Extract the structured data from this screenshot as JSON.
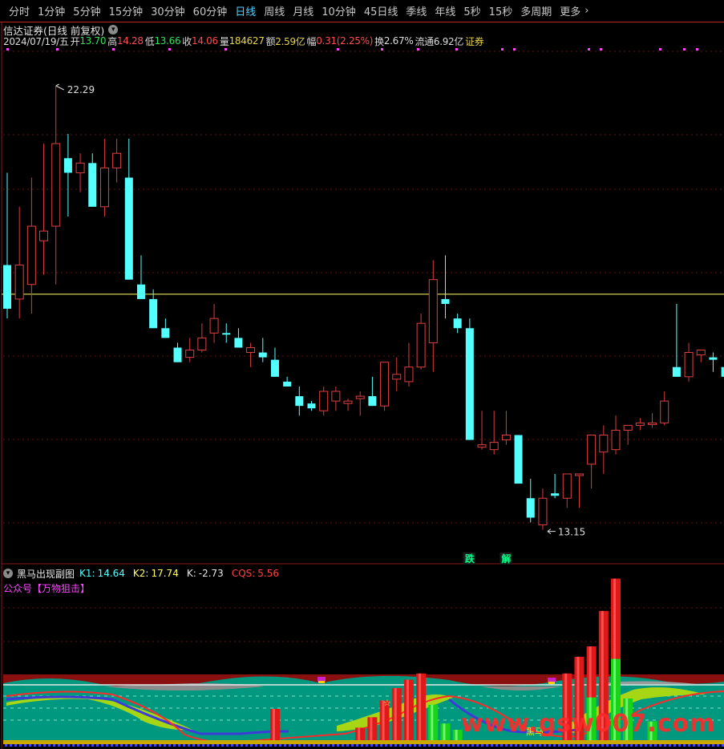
{
  "toolbar": {
    "tabs": [
      {
        "label": "分时"
      },
      {
        "label": "1分钟"
      },
      {
        "label": "5分钟"
      },
      {
        "label": "15分钟"
      },
      {
        "label": "30分钟"
      },
      {
        "label": "60分钟"
      },
      {
        "label": "日线",
        "active": true
      },
      {
        "label": "周线"
      },
      {
        "label": "月线"
      },
      {
        "label": "10分钟"
      },
      {
        "label": "45日线"
      },
      {
        "label": "季线"
      },
      {
        "label": "年线"
      },
      {
        "label": "5秒"
      },
      {
        "label": "15秒"
      },
      {
        "label": "多周期"
      },
      {
        "label": "更多"
      }
    ],
    "more_arrow": "›"
  },
  "stock": {
    "name": "信达证券",
    "mode": "(日线 前复权)",
    "caret": "▾"
  },
  "price_bar": {
    "date": "2024/07/19/五",
    "open_label": "开",
    "open": "13.70",
    "high_label": "高",
    "high": "14.28",
    "low_label": "低",
    "low": "13.66",
    "close_label": "收",
    "close": "14.06",
    "volume_label": "量",
    "volume": "184627",
    "amount_label": "额",
    "amount": "2.59亿",
    "change_label": "幅",
    "change": "0.31(2.25%)",
    "turnover_label": "换",
    "turnover": "2.67%",
    "float_label": "流通",
    "float": "6.92亿",
    "sector": "证券"
  },
  "annotations": {
    "high_marker": "22.29",
    "low_marker": "13.15",
    "die": "跌",
    "jie": "解"
  },
  "indicator": {
    "name": "黑马出现副图",
    "caret": "▾",
    "k1_label": "K1:",
    "k1": "14.64",
    "k2_label": "K2:",
    "k2": "17.74",
    "k_label": "K:",
    "k": "-2.73",
    "cqs_label": "CQS:",
    "cqs": "5.56",
    "subtitle": "公众号【万物狙击】",
    "star": "☆",
    "heima_label": "黑马"
  },
  "watermark": "www.gsw007.com",
  "colors": {
    "up": "#ff3b3b",
    "down": "#54ffff",
    "bg": "#000000",
    "panel": "#009980",
    "grid": "#7a1010",
    "ref_line": "#ffff66",
    "active_tab": "#4fd0ff"
  },
  "chart_data": {
    "type": "candlestick",
    "price_range": [
      12.5,
      23.0
    ],
    "reference_price": 18.0,
    "candles": [
      {
        "o": 18.6,
        "h": 20.5,
        "l": 17.5,
        "c": 17.7,
        "d": "down"
      },
      {
        "o": 17.9,
        "h": 19.8,
        "l": 17.5,
        "c": 18.6,
        "d": "up"
      },
      {
        "o": 18.2,
        "h": 20.4,
        "l": 17.6,
        "c": 19.4,
        "d": "up"
      },
      {
        "o": 19.1,
        "h": 21.1,
        "l": 18.4,
        "c": 19.3,
        "d": "up"
      },
      {
        "o": 19.4,
        "h": 22.29,
        "l": 18.2,
        "c": 21.1,
        "d": "up"
      },
      {
        "o": 20.8,
        "h": 21.3,
        "l": 19.6,
        "c": 20.5,
        "d": "down"
      },
      {
        "o": 20.5,
        "h": 20.9,
        "l": 20.1,
        "c": 20.7,
        "d": "up"
      },
      {
        "o": 20.7,
        "h": 20.9,
        "l": 19.8,
        "c": 19.8,
        "d": "down"
      },
      {
        "o": 19.8,
        "h": 21.2,
        "l": 19.6,
        "c": 20.6,
        "d": "up"
      },
      {
        "o": 20.6,
        "h": 21.2,
        "l": 20.3,
        "c": 20.9,
        "d": "up"
      },
      {
        "o": 20.4,
        "h": 21.2,
        "l": 18.3,
        "c": 18.3,
        "d": "down"
      },
      {
        "o": 18.2,
        "h": 18.8,
        "l": 17.9,
        "c": 17.9,
        "d": "down"
      },
      {
        "o": 17.9,
        "h": 18.1,
        "l": 17.3,
        "c": 17.3,
        "d": "down"
      },
      {
        "o": 17.3,
        "h": 17.5,
        "l": 17.1,
        "c": 17.1,
        "d": "down"
      },
      {
        "o": 16.9,
        "h": 17.0,
        "l": 16.6,
        "c": 16.6,
        "d": "down"
      },
      {
        "o": 16.7,
        "h": 17.1,
        "l": 16.6,
        "c": 16.85,
        "d": "up"
      },
      {
        "o": 16.85,
        "h": 17.4,
        "l": 16.8,
        "c": 17.1,
        "d": "up"
      },
      {
        "o": 17.2,
        "h": 17.8,
        "l": 17.0,
        "c": 17.5,
        "d": "up"
      },
      {
        "o": 17.2,
        "h": 17.4,
        "l": 17.0,
        "c": 17.2,
        "d": "down"
      },
      {
        "o": 17.1,
        "h": 17.3,
        "l": 16.9,
        "c": 16.9,
        "d": "down"
      },
      {
        "o": 16.8,
        "h": 17.0,
        "l": 16.5,
        "c": 16.9,
        "d": "up"
      },
      {
        "o": 16.8,
        "h": 17.1,
        "l": 16.6,
        "c": 16.7,
        "d": "down"
      },
      {
        "o": 16.65,
        "h": 16.9,
        "l": 16.3,
        "c": 16.3,
        "d": "down"
      },
      {
        "o": 16.2,
        "h": 16.3,
        "l": 16.1,
        "c": 16.1,
        "d": "down"
      },
      {
        "o": 15.9,
        "h": 16.1,
        "l": 15.5,
        "c": 15.7,
        "d": "down"
      },
      {
        "o": 15.75,
        "h": 15.8,
        "l": 15.6,
        "c": 15.65,
        "d": "down"
      },
      {
        "o": 15.6,
        "h": 16.1,
        "l": 15.5,
        "c": 16.0,
        "d": "up"
      },
      {
        "o": 15.8,
        "h": 16.1,
        "l": 15.6,
        "c": 16.0,
        "d": "up"
      },
      {
        "o": 15.8,
        "h": 15.85,
        "l": 15.6,
        "c": 15.75,
        "d": "up"
      },
      {
        "o": 15.85,
        "h": 16.0,
        "l": 15.5,
        "c": 15.9,
        "d": "up"
      },
      {
        "o": 15.9,
        "h": 16.3,
        "l": 15.8,
        "c": 15.7,
        "d": "down"
      },
      {
        "o": 15.7,
        "h": 16.6,
        "l": 15.6,
        "c": 16.6,
        "d": "up"
      },
      {
        "o": 16.25,
        "h": 16.7,
        "l": 16.0,
        "c": 16.35,
        "d": "up"
      },
      {
        "o": 16.2,
        "h": 17.0,
        "l": 16.1,
        "c": 16.5,
        "d": "up"
      },
      {
        "o": 16.5,
        "h": 17.6,
        "l": 16.45,
        "c": 17.4,
        "d": "up"
      },
      {
        "o": 17.0,
        "h": 18.7,
        "l": 16.4,
        "c": 18.3,
        "d": "up"
      },
      {
        "o": 17.9,
        "h": 18.8,
        "l": 17.5,
        "c": 17.8,
        "d": "down"
      },
      {
        "o": 17.5,
        "h": 17.6,
        "l": 17.2,
        "c": 17.3,
        "d": "down"
      },
      {
        "o": 17.3,
        "h": 17.5,
        "l": 16.4,
        "c": 15.0,
        "d": "down"
      },
      {
        "o": 14.85,
        "h": 15.6,
        "l": 14.8,
        "c": 14.9,
        "d": "up"
      },
      {
        "o": 14.8,
        "h": 15.6,
        "l": 14.7,
        "c": 14.95,
        "d": "up"
      },
      {
        "o": 15.0,
        "h": 15.6,
        "l": 14.9,
        "c": 15.1,
        "d": "up"
      },
      {
        "o": 15.1,
        "h": 15.0,
        "l": 14.3,
        "c": 14.1,
        "d": "down"
      },
      {
        "o": 13.8,
        "h": 14.2,
        "l": 13.3,
        "c": 13.4,
        "d": "down"
      },
      {
        "o": 13.25,
        "h": 14.0,
        "l": 13.15,
        "c": 13.8,
        "d": "up"
      },
      {
        "o": 13.85,
        "h": 14.3,
        "l": 13.8,
        "c": 13.9,
        "d": "down"
      },
      {
        "o": 13.8,
        "h": 14.2,
        "l": 13.6,
        "c": 14.3,
        "d": "up"
      },
      {
        "o": 14.3,
        "h": 14.3,
        "l": 13.6,
        "c": 14.3,
        "d": "up"
      },
      {
        "o": 14.5,
        "h": 15.1,
        "l": 14.0,
        "c": 15.1,
        "d": "up"
      },
      {
        "o": 15.1,
        "h": 15.3,
        "l": 14.3,
        "c": 14.75,
        "d": "up"
      },
      {
        "o": 14.8,
        "h": 15.5,
        "l": 14.7,
        "c": 15.2,
        "d": "up"
      },
      {
        "o": 15.2,
        "h": 15.2,
        "l": 14.9,
        "c": 15.3,
        "d": "up"
      },
      {
        "o": 15.3,
        "h": 15.45,
        "l": 15.2,
        "c": 15.35,
        "d": "up"
      },
      {
        "o": 15.35,
        "h": 15.55,
        "l": 15.25,
        "c": 15.35,
        "d": "up"
      },
      {
        "o": 15.35,
        "h": 16.0,
        "l": 15.3,
        "c": 15.8,
        "d": "up"
      },
      {
        "o": 16.5,
        "h": 17.8,
        "l": 16.3,
        "c": 16.3,
        "d": "down"
      },
      {
        "o": 16.3,
        "h": 17.0,
        "l": 16.2,
        "c": 16.8,
        "d": "up"
      },
      {
        "o": 16.75,
        "h": 16.85,
        "l": 16.6,
        "c": 16.85,
        "d": "up"
      },
      {
        "o": 16.7,
        "h": 16.8,
        "l": 16.4,
        "c": 16.65,
        "d": "down"
      },
      {
        "o": 16.5,
        "h": 16.7,
        "l": 16.3,
        "c": 16.3,
        "d": "down"
      },
      {
        "o": 16.3,
        "h": 16.75,
        "l": 16.1,
        "c": 16.35,
        "d": "up"
      }
    ]
  },
  "indicator_data": {
    "red_bars": [
      {
        "i": 13,
        "v": 0.3
      },
      {
        "i": 20,
        "v": 0.12
      },
      {
        "i": 21,
        "v": 0.22
      },
      {
        "i": 22,
        "v": 0.38
      },
      {
        "i": 23,
        "v": 0.5
      },
      {
        "i": 24,
        "v": 0.58
      },
      {
        "i": 25,
        "v": 0.64
      },
      {
        "i": 37,
        "v": 0.64
      },
      {
        "i": 38,
        "v": 0.8
      },
      {
        "i": 39,
        "v": 0.9
      },
      {
        "i": 40,
        "v": 1.24
      },
      {
        "i": 41,
        "v": 1.55
      }
    ],
    "green_bars": [
      {
        "i": 26,
        "v": 0.34
      },
      {
        "i": 27,
        "v": 0.16
      },
      {
        "i": 28,
        "v": 0.1
      },
      {
        "i": 39,
        "v": 0.41
      },
      {
        "i": 41,
        "v": 0.78
      },
      {
        "i": 42,
        "v": 0.4
      },
      {
        "i": 44,
        "v": 0.18
      }
    ]
  }
}
